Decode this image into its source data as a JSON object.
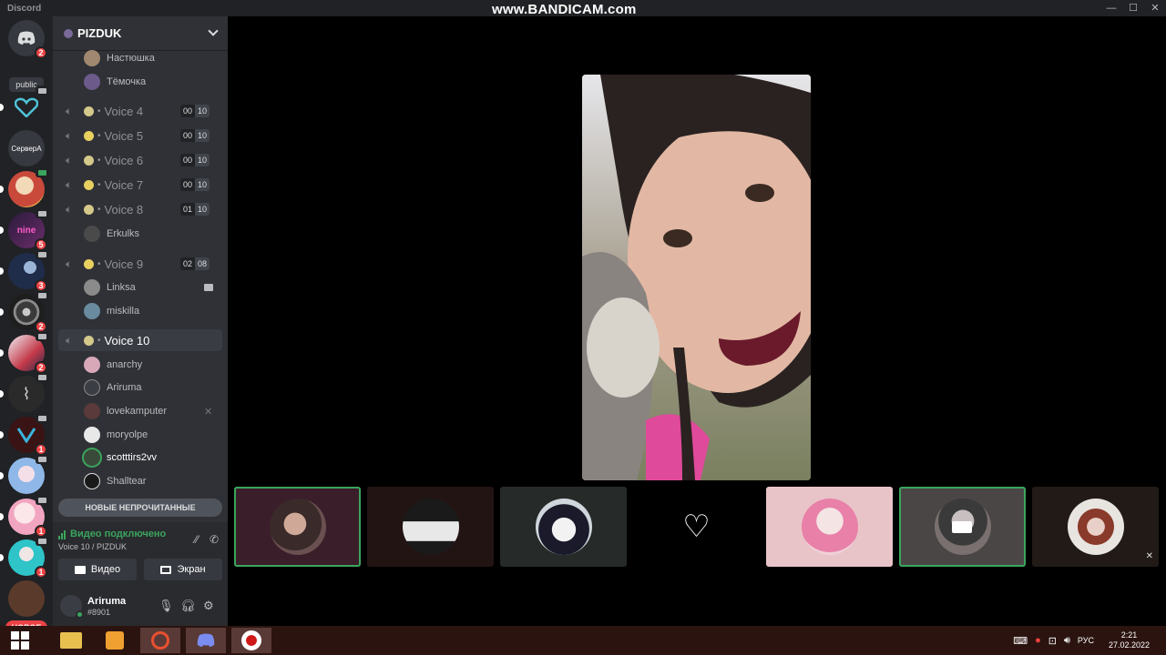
{
  "titlebar": {
    "app_name": "Discord",
    "watermark": "www.BANDICAM.com",
    "controls": [
      "—",
      "☐",
      "✕"
    ]
  },
  "rail": {
    "home_badge": "2",
    "public_label": "public",
    "server_text": "СервeрА",
    "servers": [
      {
        "badge": ""
      },
      {
        "badge": ""
      },
      {
        "badge": ""
      },
      {
        "badge": "5"
      },
      {
        "badge": "3"
      },
      {
        "badge": "2"
      },
      {
        "badge": "2"
      },
      {
        "badge": ""
      },
      {
        "badge": "1"
      },
      {
        "badge": ""
      },
      {
        "badge": "1"
      },
      {
        "badge": "1"
      }
    ],
    "new_label": "НОВОЕ"
  },
  "guild": {
    "name": "PIZDUK"
  },
  "channels": {
    "top_users": [
      "Настюшка",
      "Тёмочка"
    ],
    "voice": [
      {
        "name": "Voice 4",
        "a": "00",
        "b": "10"
      },
      {
        "name": "Voice 5",
        "a": "00",
        "b": "10"
      },
      {
        "name": "Voice 6",
        "a": "00",
        "b": "10"
      },
      {
        "name": "Voice 7",
        "a": "00",
        "b": "10"
      },
      {
        "name": "Voice 8",
        "a": "01",
        "b": "10"
      },
      {
        "name": "Voice 9",
        "a": "02",
        "b": "08"
      },
      {
        "name": "Voice 10"
      }
    ],
    "voice8_users": [
      "Erkulks"
    ],
    "voice9_users": [
      "Linksa",
      "miskilla"
    ],
    "voice10_users": [
      "anarchy",
      "Ariruma",
      "lovekamputer",
      "moryolpe",
      "scotttirs2vv",
      "Shalltear"
    ],
    "unread_banner": "НОВЫЕ НЕПРОЧИТАННЫЕ"
  },
  "voice_panel": {
    "status": "Видео подключено",
    "location": "Voice 10 / PIZDUK",
    "video_label": "Видео",
    "screen_label": "Экран"
  },
  "user_panel": {
    "name": "Ariruma",
    "tag": "#8901"
  },
  "colors": {
    "accent_green": "#3ba55d",
    "badge_red": "#ed4245",
    "blurple": "#5865f2"
  },
  "taskbar": {
    "lang": "РУС",
    "time": "2:21",
    "date": "27.02.2022"
  }
}
